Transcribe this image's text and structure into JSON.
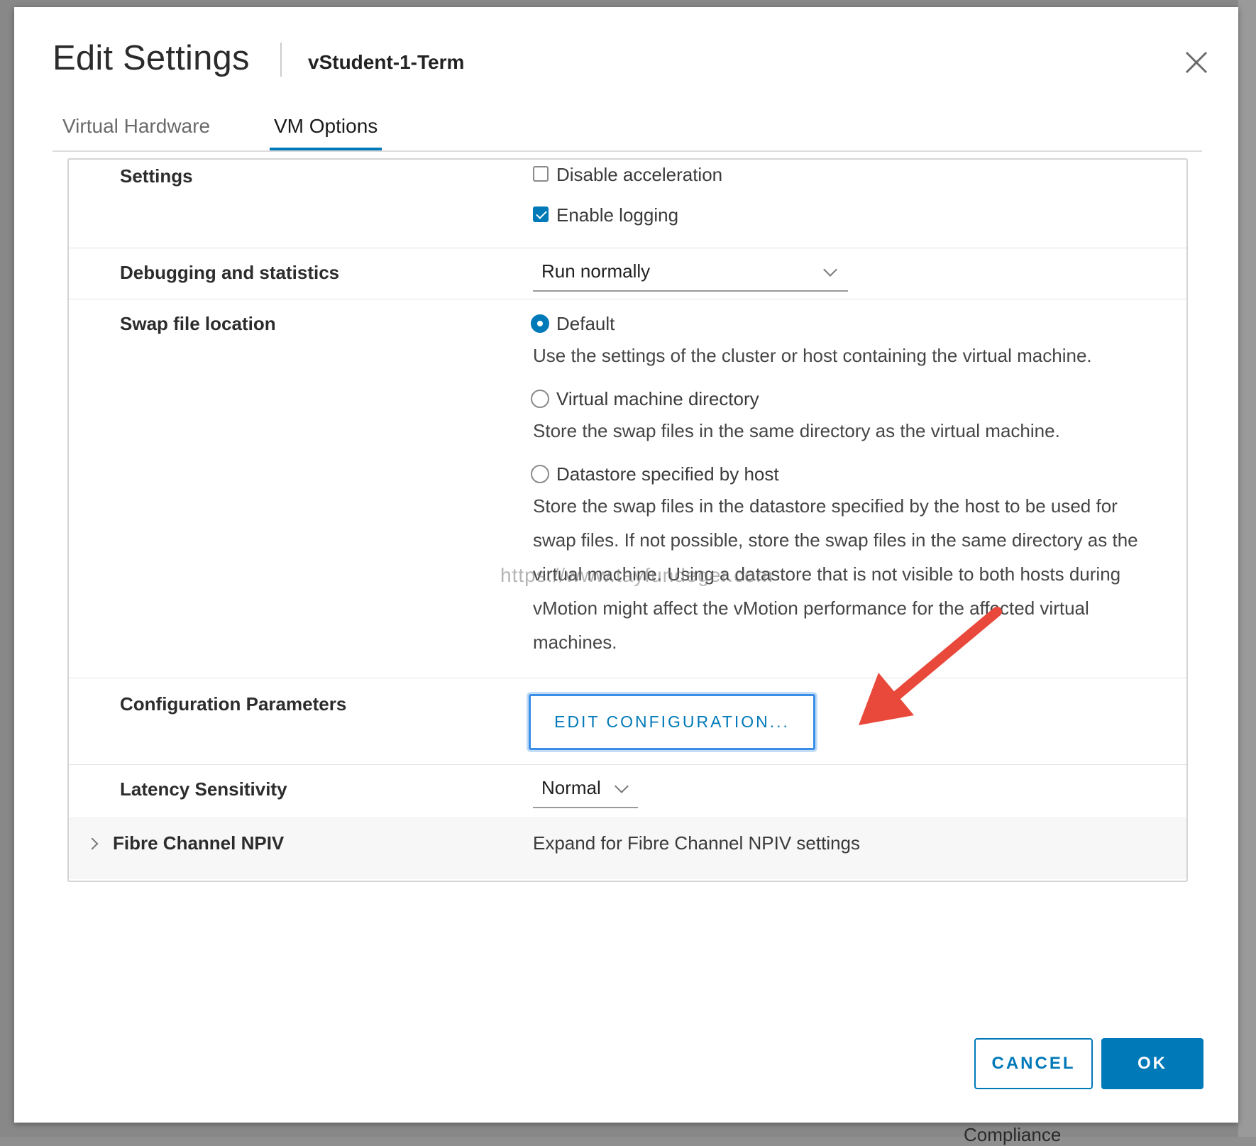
{
  "dialog": {
    "title": "Edit Settings",
    "subtitle": "vStudent-1-Term"
  },
  "tabs": [
    {
      "label": "Virtual Hardware",
      "active": false
    },
    {
      "label": "VM Options",
      "active": true
    }
  ],
  "settings": {
    "label": "Settings",
    "disable_acceleration": {
      "label": "Disable acceleration",
      "checked": false
    },
    "enable_logging": {
      "label": "Enable logging",
      "checked": true
    }
  },
  "debugging": {
    "label": "Debugging and statistics",
    "value": "Run normally"
  },
  "swap": {
    "label": "Swap file location",
    "options": [
      {
        "label": "Default",
        "selected": true,
        "desc": "Use the settings of the cluster or host containing the virtual machine."
      },
      {
        "label": "Virtual machine directory",
        "selected": false,
        "desc": "Store the swap files in the same directory as the virtual machine."
      },
      {
        "label": "Datastore specified by host",
        "selected": false,
        "desc": "Store the swap files in the datastore specified by the host to be used for swap files. If not possible, store the swap files in the same directory as the virtual machine. Using a datastore that is not visible to both hosts during vMotion might affect the vMotion performance for the affected virtual machines."
      }
    ]
  },
  "config_params": {
    "label": "Configuration Parameters",
    "button": "EDIT CONFIGURATION..."
  },
  "latency": {
    "label": "Latency Sensitivity",
    "value": "Normal"
  },
  "npiv": {
    "label": "Fibre Channel NPIV",
    "desc": "Expand for Fibre Channel NPIV settings"
  },
  "watermark": "https://www.tayfundeger.com",
  "footer": {
    "cancel": "CANCEL",
    "ok": "OK"
  },
  "background": {
    "partial_text": "Compliance"
  },
  "colors": {
    "accent": "#0079b8",
    "arrow": "#e8493a"
  }
}
